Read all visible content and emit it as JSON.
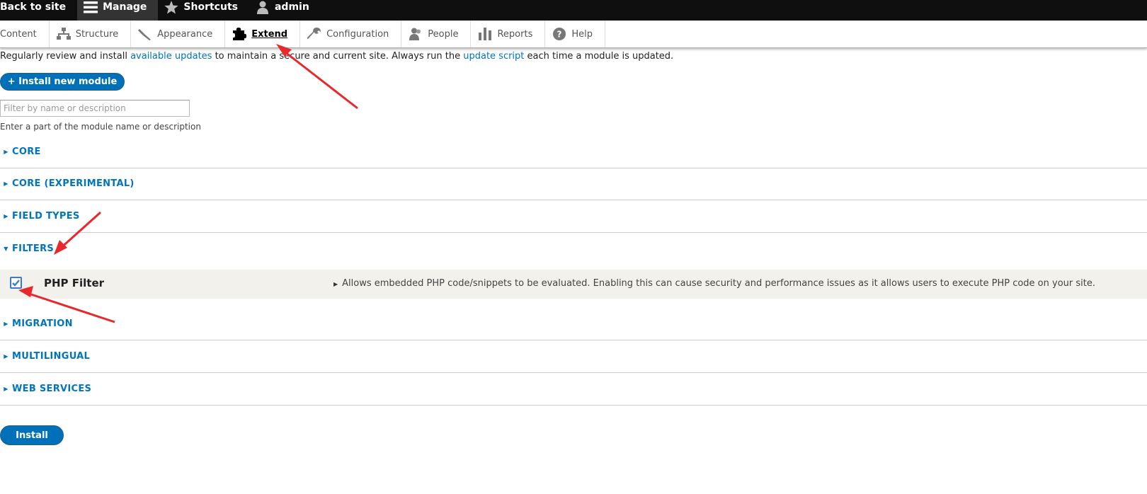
{
  "toolbar": {
    "back_to_site": "Back to site",
    "manage": "Manage",
    "shortcuts": "Shortcuts",
    "user": "admin"
  },
  "tray": {
    "items": [
      {
        "label": "Content"
      },
      {
        "label": "Structure"
      },
      {
        "label": "Appearance"
      },
      {
        "label": "Extend"
      },
      {
        "label": "Configuration"
      },
      {
        "label": "People"
      },
      {
        "label": "Reports"
      },
      {
        "label": "Help"
      }
    ]
  },
  "intro": {
    "part1": "Regularly review and install ",
    "link1": "available updates",
    "part2": " to maintain a secure and current site. Always run the ",
    "link2": "update script",
    "part3": " each time a module is updated."
  },
  "install_new_label": "+ Install new module",
  "filter": {
    "placeholder": "Filter by name or description",
    "description": "Enter a part of the module name or description"
  },
  "packages": [
    {
      "label": "CORE",
      "open": false
    },
    {
      "label": "CORE (EXPERIMENTAL)",
      "open": false
    },
    {
      "label": "FIELD TYPES",
      "open": false
    },
    {
      "label": "FILTERS",
      "open": true
    },
    {
      "label": "MIGRATION",
      "open": false
    },
    {
      "label": "MULTILINGUAL",
      "open": false
    },
    {
      "label": "WEB SERVICES",
      "open": false
    }
  ],
  "module": {
    "name": "PHP Filter",
    "checked": true,
    "description": "Allows embedded PHP code/snippets to be evaluated. Enabling this can cause security and performance issues as it allows users to execute PHP code on your site."
  },
  "install_label": "Install",
  "colors": {
    "link": "#0074bd",
    "button": "#0071b8",
    "toolbar": "#0f0f0f",
    "annotation": "#e8282d"
  }
}
